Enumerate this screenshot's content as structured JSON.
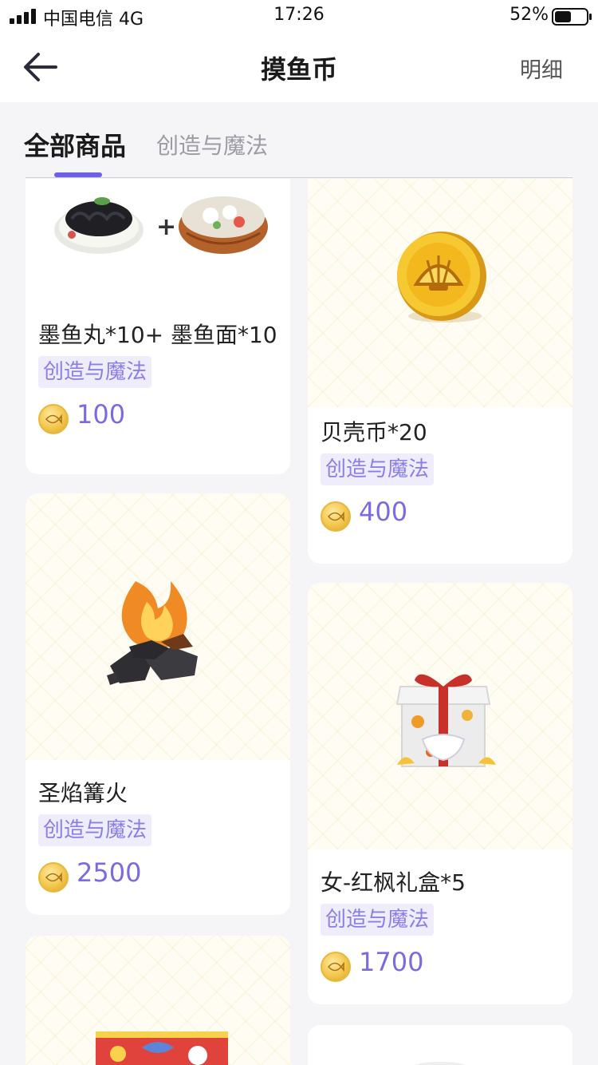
{
  "status_bar": {
    "carrier": "中国电信 4G",
    "time": "17:26",
    "battery": "52%",
    "battery_level": 0.52
  },
  "nav": {
    "title": "摸鱼币",
    "detail_label": "明细",
    "back_icon": "back-arrow-icon"
  },
  "tabs": [
    {
      "label": "全部商品",
      "active": true
    },
    {
      "label": "创造与魔法",
      "active": false
    }
  ],
  "products": [
    {
      "name": "墨鱼丸*10+ 墨鱼面*10",
      "tag": "创造与魔法",
      "price": "100",
      "icon": "squid-noodles-and-balls-icon"
    },
    {
      "name": "贝壳币*20",
      "tag": "创造与魔法",
      "price": "400",
      "icon": "shell-coin-icon"
    },
    {
      "name": "圣焰篝火",
      "tag": "创造与魔法",
      "price": "2500",
      "icon": "bonfire-icon"
    },
    {
      "name": "女-红枫礼盒*5",
      "tag": "创造与魔法",
      "price": "1700",
      "icon": "gift-box-icon"
    },
    {
      "name": "",
      "tag": "",
      "price": "",
      "icon": "gift-box-red-icon"
    },
    {
      "name": "",
      "tag": "",
      "price": "",
      "icon": "item-icon"
    }
  ],
  "colors": {
    "accent": "#6e60e6",
    "price": "#7a6be0",
    "tag_bg": "#efedfb",
    "tag_text": "#8a7ee8",
    "page_bg": "#f5f5f7"
  }
}
